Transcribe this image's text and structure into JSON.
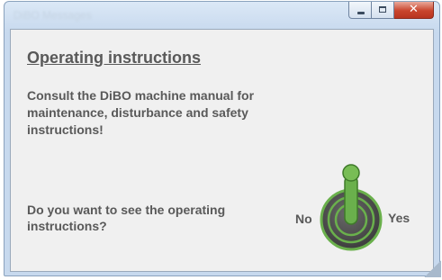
{
  "window": {
    "title": "DiBO Messages"
  },
  "content": {
    "heading": "Operating instructions",
    "info_text": "Consult the DiBO machine manual for maintenance, disturbance and safety instructions!",
    "question": "Do you want to see the operating instructions?",
    "no_label": "No",
    "yes_label": "Yes"
  },
  "toggle": {
    "state": "yes",
    "accent_color": "#6ab04c"
  }
}
